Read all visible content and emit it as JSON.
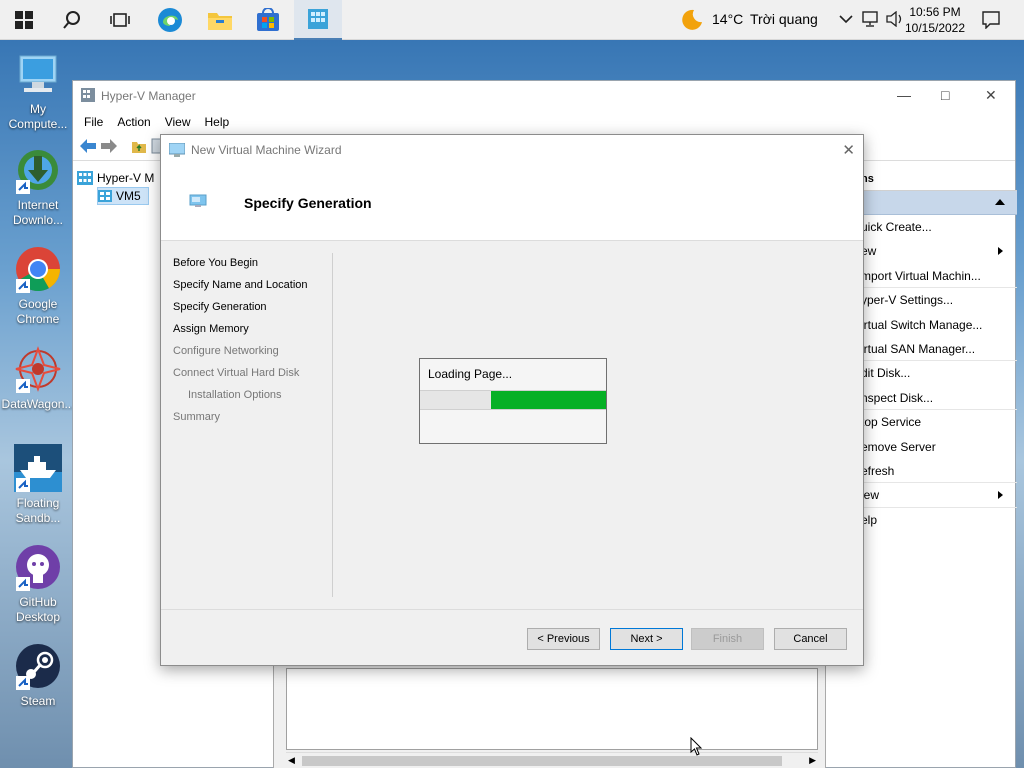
{
  "taskbar": {
    "apps": [
      {
        "name": "start-icon"
      },
      {
        "name": "search-icon"
      },
      {
        "name": "task-view-icon"
      },
      {
        "name": "edge-icon"
      },
      {
        "name": "file-explorer-icon"
      },
      {
        "name": "store-icon"
      },
      {
        "name": "hyperv-icon",
        "active": true
      }
    ],
    "weather_temp": "14°C",
    "weather_desc": "Trời quang",
    "time": "10:56 PM",
    "date": "10/15/2022"
  },
  "desktop": {
    "icons": [
      {
        "label": "My Compute..."
      },
      {
        "label": "Internet Downlo..."
      },
      {
        "label": "Google Chrome"
      },
      {
        "label": "DataWagon..."
      },
      {
        "label": "Floating Sandb..."
      },
      {
        "label": "GitHub Desktop"
      },
      {
        "label": "Steam"
      }
    ]
  },
  "hyperv": {
    "title": "Hyper-V Manager",
    "menu": [
      "File",
      "Action",
      "View",
      "Help"
    ],
    "tree_root": "Hyper-V M",
    "tree_child": "VM5",
    "actions_header": "ns",
    "actions": [
      "uick Create...",
      "ew",
      "mport Virtual Machin...",
      "yper-V Settings...",
      "irtual Switch Manage...",
      "irtual SAN Manager...",
      "dit Disk...",
      "nspect Disk...",
      "top Service",
      "emove Server",
      "efresh",
      "iew",
      "elp"
    ]
  },
  "wizard": {
    "title": "New Virtual Machine Wizard",
    "header": "Specify Generation",
    "steps": [
      {
        "label": "Before You Begin",
        "state": "done"
      },
      {
        "label": "Specify Name and Location",
        "state": "done"
      },
      {
        "label": "Specify Generation",
        "state": "current"
      },
      {
        "label": "Assign Memory",
        "state": "done"
      },
      {
        "label": "Configure Networking",
        "state": "dim"
      },
      {
        "label": "Connect Virtual Hard Disk",
        "state": "dim"
      },
      {
        "label": "Installation Options",
        "state": "dim-indent"
      },
      {
        "label": "Summary",
        "state": "dim"
      }
    ],
    "loading_text": "Loading Page...",
    "progress": {
      "start_fraction": 0.38,
      "end_fraction": 1.0
    },
    "buttons": {
      "previous": "< Previous",
      "next": "Next >",
      "finish": "Finish",
      "cancel": "Cancel"
    }
  }
}
